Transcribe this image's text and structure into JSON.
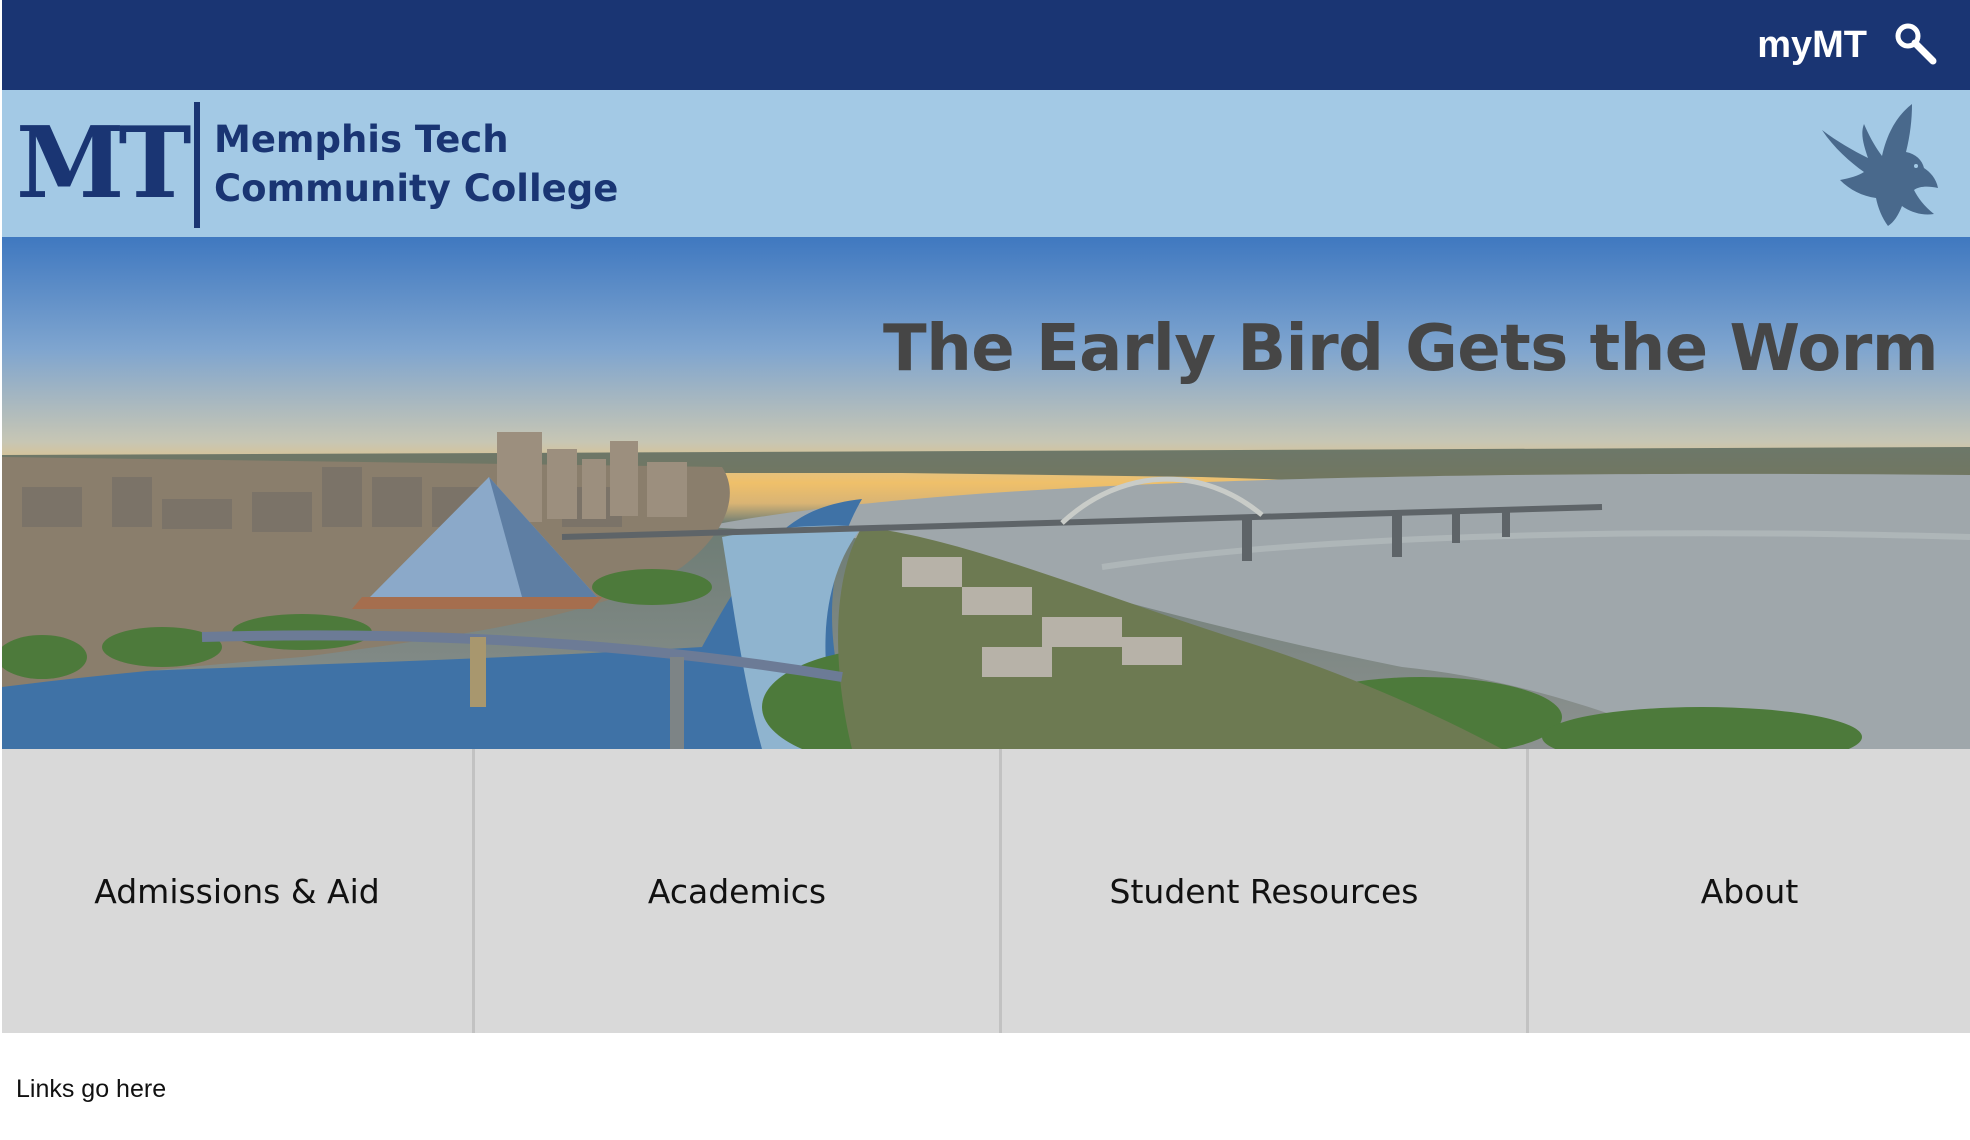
{
  "topbar": {
    "portal_label": "myMT",
    "search_icon": "magnifier-icon",
    "background": "#1a3573"
  },
  "brand": {
    "logo_mark": "MT",
    "name_line1": "Memphis Tech",
    "name_line2": "Community College",
    "mascot_icon": "bird-icon",
    "background": "#a3c9e5",
    "accent": "#1a3573"
  },
  "hero": {
    "headline": "The Early Bird Gets the Worm"
  },
  "nav": {
    "items": [
      {
        "label": "Admissions & Aid"
      },
      {
        "label": "Academics"
      },
      {
        "label": "Student Resources"
      },
      {
        "label": "About"
      }
    ],
    "background": "#d9d9d9"
  },
  "footer": {
    "links_placeholder": "Links go here"
  }
}
